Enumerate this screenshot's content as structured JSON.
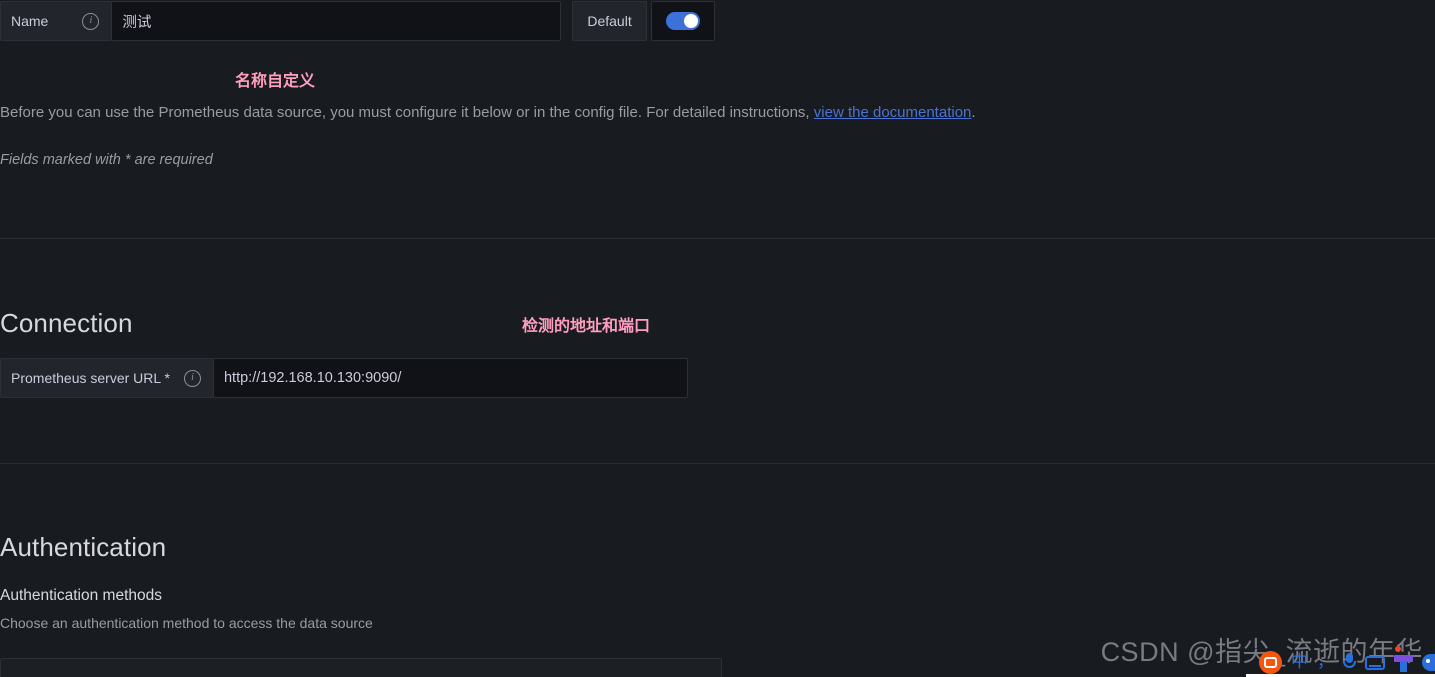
{
  "theme": {
    "background": "#181b1f",
    "input_background": "#111217",
    "prefix_background": "#22252b",
    "border": "#2d3037",
    "text_primary": "#ccccdc",
    "text_secondary": "#9a9ba5",
    "link": "#4a73d4",
    "accent_toggle": "#3d71d9",
    "annotation_pink": "#ff9ebe"
  },
  "name_field": {
    "label": "Name",
    "info_icon": "info-icon",
    "value": "测试",
    "default_label": "Default",
    "toggle_state": "on"
  },
  "annotations": {
    "name_annotation": "名称自定义",
    "connection_annotation": "检测的地址和端口"
  },
  "intro": {
    "before_link": "Before you can use the Prometheus data source, you must configure it below or in the config file. For detailed instructions, ",
    "link_text": "view the documentation",
    "after_link": ".",
    "required_note": "Fields marked with * are required"
  },
  "connection": {
    "title": "Connection",
    "url_label": "Prometheus server URL *",
    "info_icon": "info-icon",
    "url_value": "http://192.168.10.130:9090/"
  },
  "authentication": {
    "title": "Authentication",
    "methods_heading": "Authentication methods",
    "methods_description": "Choose an authentication method to access the data source"
  },
  "watermark": {
    "text": "CSDN @指尖_流逝的年华"
  },
  "ime_toolbar": {
    "logo": "sogou-logo-icon",
    "mode": "中",
    "punctuation": "，",
    "mic": "microphone-icon",
    "keyboard": "keyboard-icon",
    "toolbox": "toolbox-icon",
    "emoji": "emoji-face-icon"
  }
}
